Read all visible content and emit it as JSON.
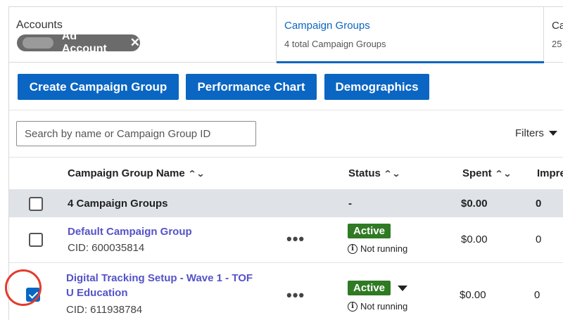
{
  "tabs": {
    "accounts": {
      "title": "Accounts",
      "pill_label": "Ad Account",
      "close_glyph": "✕"
    },
    "campaign_groups": {
      "title": "Campaign Groups",
      "subtitle": "4 total Campaign Groups"
    },
    "campaigns": {
      "title": "Ca",
      "subtitle": "25"
    }
  },
  "toolbar": {
    "create_label": "Create Campaign Group",
    "performance_label": "Performance Chart",
    "demographics_label": "Demographics"
  },
  "search": {
    "placeholder": "Search by name or Campaign Group ID"
  },
  "filters": {
    "label": "Filters"
  },
  "table": {
    "headers": {
      "name": "Campaign Group Name",
      "status": "Status",
      "spent": "Spent",
      "impressions": "Impre"
    },
    "sort_glyph": "⌃⌄",
    "summary": {
      "name": "4 Campaign Groups",
      "status": "-",
      "spent": "$0.00",
      "impressions": "0"
    },
    "rows": [
      {
        "name": "Default Campaign Group",
        "cid": "CID: 600035814",
        "status": "Active",
        "status_detail": "Not running",
        "spent": "$0.00",
        "impressions": "0",
        "checked": false
      },
      {
        "name_line1": "Digital Tracking Setup - Wave 1 - TOF",
        "name_line2": "U Education",
        "cid": "CID: 611938784",
        "status": "Active",
        "status_detail": "Not running",
        "spent": "$0.00",
        "impressions": "0",
        "checked": true
      }
    ],
    "more_glyph": "•••",
    "info_glyph": "i"
  },
  "colors": {
    "accent": "#0a66c2",
    "link": "#5552c9",
    "active_badge": "#2f7a23",
    "highlight_ring": "#e23b2e"
  }
}
